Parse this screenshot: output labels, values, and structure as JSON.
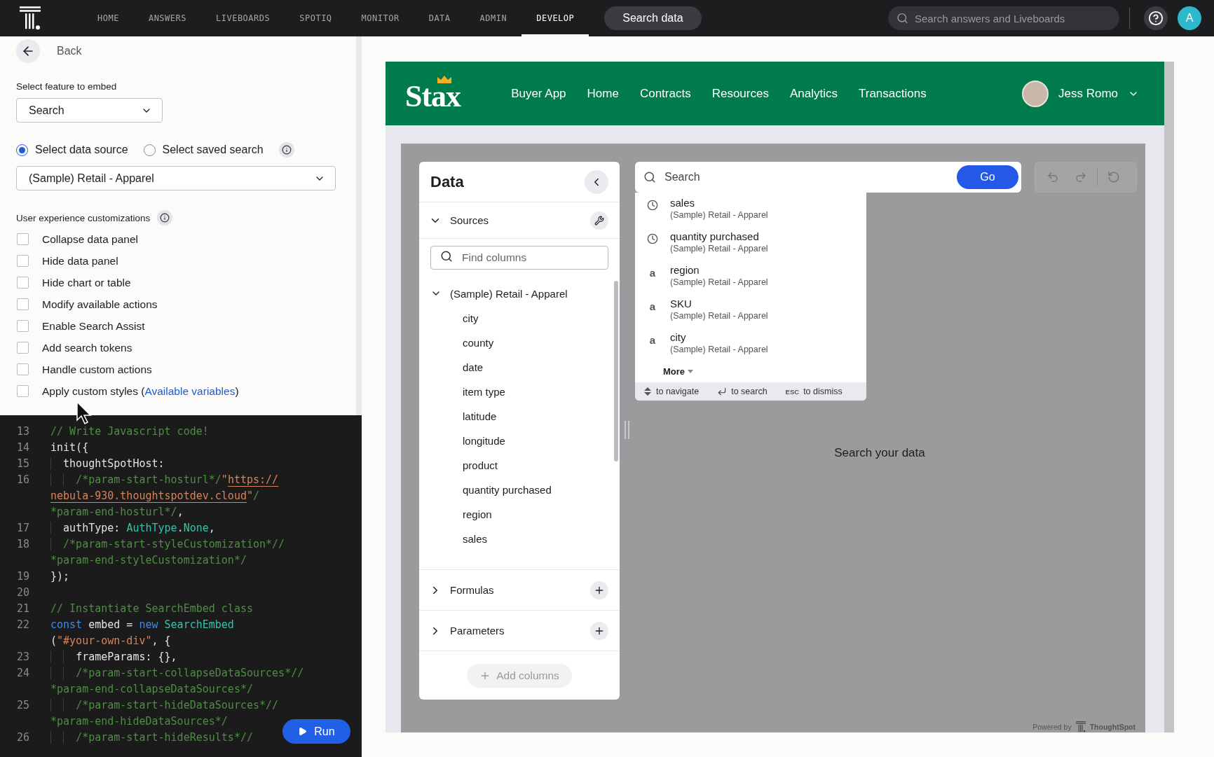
{
  "topbar": {
    "nav": [
      {
        "label": "HOME",
        "selected": false
      },
      {
        "label": "ANSWERS",
        "selected": false
      },
      {
        "label": "LIVEBOARDS",
        "selected": false
      },
      {
        "label": "SPOTIQ",
        "selected": false
      },
      {
        "label": "MONITOR",
        "selected": false
      },
      {
        "label": "DATA",
        "selected": false
      },
      {
        "label": "ADMIN",
        "selected": false
      },
      {
        "label": "DEVELOP",
        "selected": true
      }
    ],
    "search_button": "Search data",
    "search": {
      "placeholder": "Search answers and Liveboards"
    },
    "avatar": "A"
  },
  "config": {
    "back": "Back",
    "feature_label": "Select feature to embed",
    "feature_value": "Search",
    "source_modes": [
      {
        "label": "Select data source",
        "selected": true
      },
      {
        "label": "Select saved search",
        "selected": false
      }
    ],
    "source_value": "(Sample) Retail - Apparel",
    "customizations_label": "User experience customizations",
    "options": [
      {
        "label": "Collapse data panel",
        "checked": false
      },
      {
        "label": "Hide data panel",
        "checked": false
      },
      {
        "label": "Hide chart or table",
        "checked": false
      },
      {
        "label": "Modify available actions",
        "checked": false
      },
      {
        "label": "Enable Search Assist",
        "checked": false
      },
      {
        "label": "Add search tokens",
        "checked": false
      },
      {
        "label": "Handle custom actions",
        "checked": false
      },
      {
        "label": "Apply custom styles (",
        "link": "Available variables",
        "after": ")",
        "checked": false
      }
    ]
  },
  "editor": {
    "rows": [
      {
        "num": "13",
        "tokens": [
          {
            "kind": "comment",
            "text": "// Write Javascript code!"
          }
        ]
      },
      {
        "num": "14",
        "tokens": [
          {
            "kind": "plain",
            "text": "init({"
          }
        ]
      },
      {
        "num": "15",
        "tokens": [
          {
            "kind": "plain",
            "text": "  thoughtSpotHost:"
          }
        ]
      },
      {
        "num": "16",
        "tokens": [
          {
            "kind": "comment",
            "text": "    /*param-start-hosturl*/"
          },
          {
            "kind": "string",
            "text": "\""
          },
          {
            "kind": "link",
            "text": "https://"
          }
        ]
      },
      {
        "tokens": [
          {
            "kind": "link",
            "text": "nebula-930.thoughtspotdev.cloud"
          },
          {
            "kind": "string",
            "text": "\""
          },
          {
            "kind": "comment",
            "text": "/"
          }
        ]
      },
      {
        "tokens": [
          {
            "kind": "comment",
            "text": "*param-end-hosturl*/"
          },
          {
            "kind": "plain",
            "text": ","
          }
        ]
      },
      {
        "num": "17",
        "tokens": [
          {
            "kind": "plain",
            "text": "  authType: "
          },
          {
            "kind": "type",
            "text": "AuthType"
          },
          {
            "kind": "plain",
            "text": "."
          },
          {
            "kind": "type",
            "text": "None"
          },
          {
            "kind": "plain",
            "text": ","
          }
        ]
      },
      {
        "num": "18",
        "tokens": [
          {
            "kind": "comment",
            "text": "  /*param-start-styleCustomization*//"
          }
        ]
      },
      {
        "tokens": [
          {
            "kind": "comment",
            "text": "*param-end-styleCustomization*/"
          }
        ]
      },
      {
        "num": "19",
        "tokens": [
          {
            "kind": "plain",
            "text": "});"
          }
        ]
      },
      {
        "num": "20",
        "tokens": []
      },
      {
        "num": "21",
        "tokens": [
          {
            "kind": "comment",
            "text": "// Instantiate SearchEmbed class"
          }
        ]
      },
      {
        "num": "22",
        "tokens": [
          {
            "kind": "keyword",
            "text": "const"
          },
          {
            "kind": "plain",
            "text": " embed = "
          },
          {
            "kind": "keyword",
            "text": "new"
          },
          {
            "kind": "type",
            "text": " SearchEmbed"
          }
        ]
      },
      {
        "tokens": [
          {
            "kind": "plain",
            "text": "("
          },
          {
            "kind": "string",
            "text": "\"#your-own-div\""
          },
          {
            "kind": "plain",
            "text": ", {"
          }
        ]
      },
      {
        "num": "23",
        "tokens": [
          {
            "kind": "plain",
            "text": "    frameParams: {},"
          }
        ]
      },
      {
        "num": "24",
        "tokens": [
          {
            "kind": "comment",
            "text": "    /*param-start-collapseDataSources*//"
          }
        ]
      },
      {
        "tokens": [
          {
            "kind": "comment",
            "text": "*param-end-collapseDataSources*/"
          }
        ]
      },
      {
        "num": "25",
        "tokens": [
          {
            "kind": "comment",
            "text": "    /*param-start-hideDataSources*//"
          }
        ]
      },
      {
        "tokens": [
          {
            "kind": "comment",
            "text": "*param-end-hideDataSources*/"
          }
        ]
      },
      {
        "num": "26",
        "tokens": [
          {
            "kind": "comment",
            "text": "    /*param-start-hideResults*//"
          }
        ]
      }
    ],
    "run": "Run"
  },
  "embed": {
    "brand": "Stax",
    "nav": [
      "Buyer App",
      "Home",
      "Contracts",
      "Resources",
      "Analytics",
      "Transactions"
    ],
    "user": "Jess Romo",
    "data_panel": {
      "title": "Data",
      "find": {
        "placeholder": "Find columns"
      },
      "sources": {
        "label": "Sources",
        "expanded": true
      },
      "tree": [
        {
          "label": "(Sample) Retail - Apparel",
          "expanded": true,
          "children": [
            {
              "label": "city"
            },
            {
              "label": "county"
            },
            {
              "label": "date"
            },
            {
              "label": "item type"
            },
            {
              "label": "latitude"
            },
            {
              "label": "longitude"
            },
            {
              "label": "product"
            },
            {
              "label": "quantity purchased"
            },
            {
              "label": "region"
            },
            {
              "label": "sales"
            }
          ]
        }
      ],
      "sections": [
        {
          "label": "Formulas",
          "expanded": false
        },
        {
          "label": "Parameters",
          "expanded": false
        }
      ],
      "add_columns": "Add columns"
    },
    "search": {
      "placeholder": "Search",
      "go": "Go"
    },
    "toolbar": [
      {
        "kind": "undo",
        "disabled": true
      },
      {
        "kind": "redo",
        "disabled": true
      },
      {
        "kind": "reset",
        "disabled": true
      }
    ],
    "suggestions": [
      {
        "kind": "recent",
        "label": "sales",
        "source": "(Sample) Retail - Apparel"
      },
      {
        "kind": "recent",
        "label": "quantity purchased",
        "source": "(Sample) Retail - Apparel"
      },
      {
        "kind": "attribute",
        "glyph": "a",
        "label": "region",
        "source": "(Sample) Retail - Apparel"
      },
      {
        "kind": "attribute",
        "glyph": "a",
        "label": "SKU",
        "source": "(Sample) Retail - Apparel"
      },
      {
        "kind": "attribute",
        "glyph": "a",
        "label": "city",
        "source": "(Sample) Retail - Apparel"
      }
    ],
    "more": "More",
    "hints": [
      {
        "kind": "updown",
        "text": "to navigate"
      },
      {
        "kind": "enter",
        "text": "to search"
      },
      {
        "kind": "esc",
        "key": "ESC",
        "text": "to dismiss"
      }
    ],
    "empty": "Search your data",
    "powered_by": "Powered by",
    "powered_brand": "ThoughtSpot"
  }
}
